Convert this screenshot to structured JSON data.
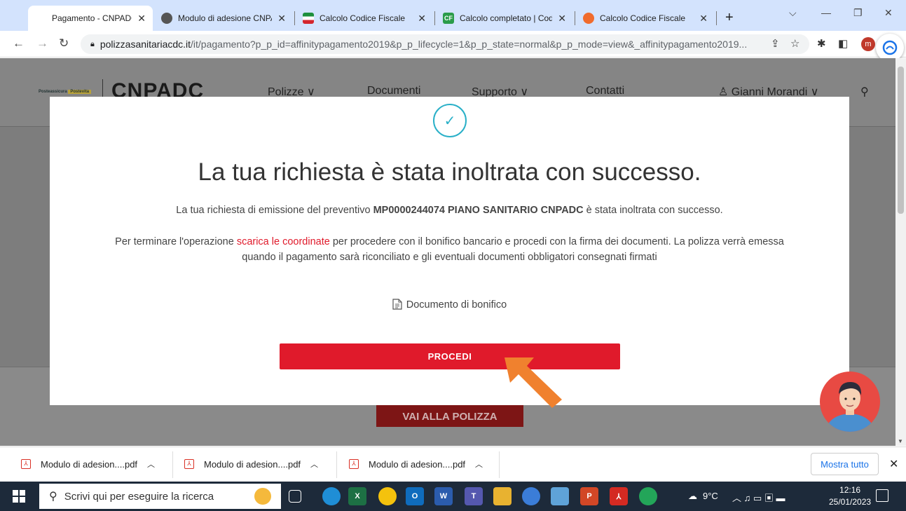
{
  "browser": {
    "tabs": [
      {
        "title": "Pagamento - CNPADC",
        "close": "✕"
      },
      {
        "title": "Modulo di adesione CNPA",
        "close": "✕"
      },
      {
        "title": "Calcolo Codice Fiscale",
        "close": "✕"
      },
      {
        "title": "Calcolo completato | Cod",
        "close": "✕"
      },
      {
        "title": "Calcolo Codice Fiscale",
        "close": "✕"
      }
    ],
    "new_tab": "+",
    "url_domain": "polizzasanitariacdc.it",
    "url_rest": "/it/pagamento?p_p_id=affinitypagamento2019&p_p_lifecycle=1&p_p_state=normal&p_p_mode=view&_affinitypagamento2019...",
    "profile_initial": "m"
  },
  "site": {
    "logo_small_a": "Posteassicura",
    "logo_small_b": "Postevita",
    "logo": "CNPADC",
    "nav": [
      "Polizze ∨",
      "Documenti",
      "Supporto ∨",
      "Contatti"
    ],
    "user": "Gianni Morandi  ∨",
    "under_button": "VAI ALLA POLIZZA"
  },
  "modal": {
    "title": "La tua richiesta è stata inoltrata con successo.",
    "p1_pre": "La tua richiesta di emissione del preventivo ",
    "p1_bold": "MP0000244074 PIANO SANITARIO CNPADC",
    "p1_post": " è stata inoltrata con successo.",
    "p2_pre": "Per terminare l'operazione ",
    "p2_link": "scarica le coordinate",
    "p2_post": " per procedere con il bonifico bancario e procedi con la firma dei documenti. La polizza verrà emessa quando il pagamento sarà riconciliato e gli eventuali documenti obbligatori consegnati firmati",
    "doc_link": "Documento di bonifico",
    "button": "PROCEDI"
  },
  "downloads": {
    "items": [
      "Modulo di adesion....pdf",
      "Modulo di adesion....pdf",
      "Modulo di adesion....pdf"
    ],
    "show_all": "Mostra tutto",
    "close": "✕"
  },
  "taskbar": {
    "search_placeholder": "Scrivi qui per eseguire la ricerca",
    "weather": "9°C",
    "time": "12:16",
    "date": "25/01/2023"
  },
  "colors": {
    "accent_red": "#e01a2b",
    "check_teal": "#2ab0c8",
    "arrow_orange": "#f0812e"
  }
}
